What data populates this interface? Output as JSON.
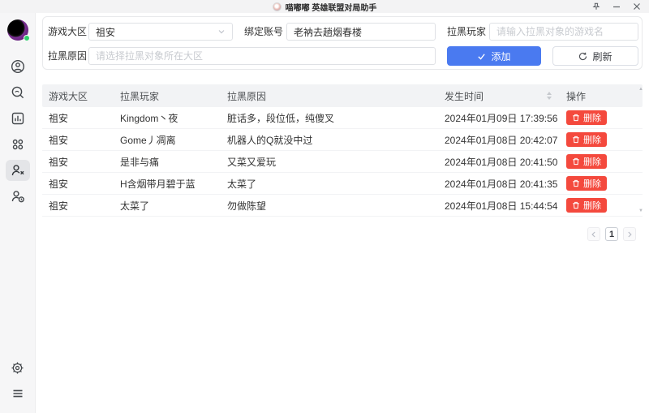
{
  "titlebar": {
    "title": "喵嘟嘟 英雄联盟对局助手"
  },
  "colors": {
    "accent_blue": "#4a7af0",
    "danger_red": "#f4493d",
    "online_green": "#2fd06c"
  },
  "icons": {
    "window": [
      "pin-icon",
      "minimize-icon",
      "close-icon"
    ],
    "sidebar": [
      "avatar",
      "profile-icon",
      "search-icon",
      "stats-icon",
      "apps-grid-icon",
      "person-x-icon",
      "person-clock-icon",
      "gear-icon",
      "hamburger-menu-icon"
    ],
    "form": [
      "chevron-down-icon",
      "check-icon",
      "refresh-icon"
    ],
    "table": [
      "sort-caret-icon",
      "trash-icon",
      "scroll-up-arrow",
      "scroll-down-arrow"
    ],
    "pagination": [
      "chevron-left-icon",
      "chevron-right-icon"
    ]
  },
  "sidebar": {
    "items": [
      {
        "name": "profile"
      },
      {
        "name": "search"
      },
      {
        "name": "stats"
      },
      {
        "name": "apps"
      },
      {
        "name": "blacklist",
        "active": true
      },
      {
        "name": "history"
      }
    ],
    "bottom": [
      {
        "name": "settings"
      },
      {
        "name": "menu"
      }
    ]
  },
  "form": {
    "region_label": "游戏大区",
    "region_value": "祖安",
    "account_label": "绑定账号",
    "account_value": "老衲去趟烟春楼",
    "player_label": "拉黑玩家",
    "player_placeholder": "请输入拉黑对象的游戏名",
    "reason_label": "拉黑原因",
    "reason_placeholder": "请选择拉黑对象所在大区",
    "add_label": "添加",
    "refresh_label": "刷新"
  },
  "table": {
    "headers": [
      "游戏大区",
      "拉黑玩家",
      "拉黑原因",
      "发生时间",
      "操作"
    ],
    "delete_label": "删除",
    "rows": [
      {
        "region": "祖安",
        "player": "Kingdom丶夜",
        "reason": "脏话多，段位低，纯傻叉",
        "time": "2024年01月09日 17:39:56"
      },
      {
        "region": "祖安",
        "player": "Gome丿凋离",
        "reason": "机器人的Q就没中过",
        "time": "2024年01月08日 20:42:07"
      },
      {
        "region": "祖安",
        "player": "是非与痛",
        "reason": "又菜又爱玩",
        "time": "2024年01月08日 20:41:50"
      },
      {
        "region": "祖安",
        "player": "H含烟带月碧于蓝",
        "reason": "太菜了",
        "time": "2024年01月08日 20:41:35"
      },
      {
        "region": "祖安",
        "player": "太菜了",
        "reason": "勿做陈望",
        "time": "2024年01月08日 15:44:54"
      }
    ]
  },
  "pagination": {
    "page": "1"
  }
}
